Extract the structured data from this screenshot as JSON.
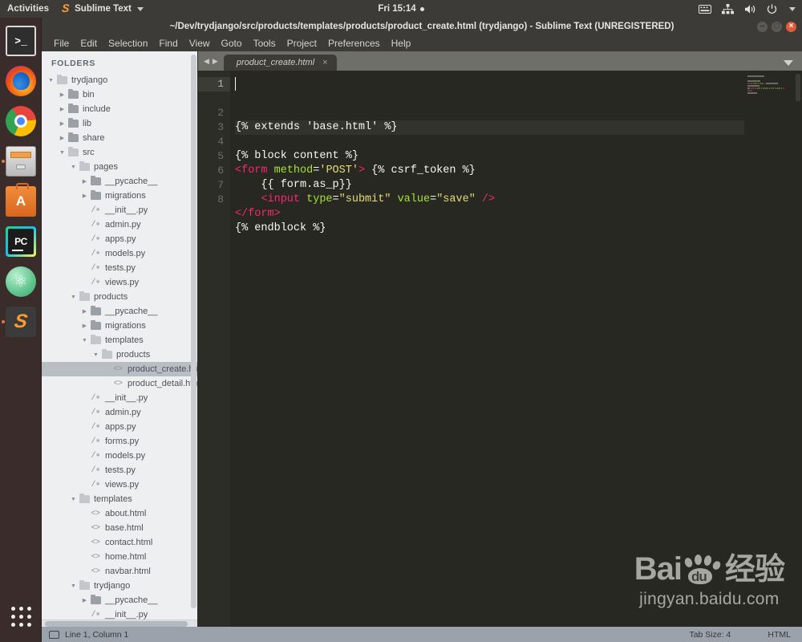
{
  "topbar": {
    "activities": "Activities",
    "app_name": "Sublime Text",
    "app_icon": "sublime-icon",
    "clock": "Fri 15:14",
    "tray_icons": [
      "keyboard-icon",
      "network-icon",
      "volume-icon",
      "power-icon"
    ]
  },
  "dock": {
    "items": [
      {
        "name": "terminal",
        "label": ">_",
        "running": false
      },
      {
        "name": "firefox",
        "label": "",
        "running": false
      },
      {
        "name": "chrome",
        "label": "",
        "running": false
      },
      {
        "name": "files",
        "label": "",
        "running": true
      },
      {
        "name": "ubuntu-software",
        "label": "A",
        "running": false
      },
      {
        "name": "pycharm",
        "label": "PC",
        "running": false
      },
      {
        "name": "atom",
        "label": "⚛",
        "running": false
      },
      {
        "name": "sublime-text",
        "label": "S",
        "running": true
      }
    ],
    "app_grid": "show-applications"
  },
  "window": {
    "title": "~/Dev/trydjango/src/products/templates/products/product_create.html (trydjango) - Sublime Text (UNREGISTERED)",
    "buttons": {
      "minimize": "–",
      "maximize": "□",
      "close": "×"
    }
  },
  "menubar": {
    "items": [
      "File",
      "Edit",
      "Selection",
      "Find",
      "View",
      "Goto",
      "Tools",
      "Project",
      "Preferences",
      "Help"
    ]
  },
  "sidebar": {
    "title": "FOLDERS",
    "scroll_position": "top",
    "tree": [
      {
        "label": "trydjango",
        "indent": 0,
        "type": "folder",
        "state": "open"
      },
      {
        "label": "bin",
        "indent": 1,
        "type": "folder",
        "state": "closed"
      },
      {
        "label": "include",
        "indent": 1,
        "type": "folder",
        "state": "closed"
      },
      {
        "label": "lib",
        "indent": 1,
        "type": "folder",
        "state": "closed"
      },
      {
        "label": "share",
        "indent": 1,
        "type": "folder",
        "state": "closed"
      },
      {
        "label": "src",
        "indent": 1,
        "type": "folder",
        "state": "open"
      },
      {
        "label": "pages",
        "indent": 2,
        "type": "folder",
        "state": "open"
      },
      {
        "label": "__pycache__",
        "indent": 3,
        "type": "folder",
        "state": "closed"
      },
      {
        "label": "migrations",
        "indent": 3,
        "type": "folder",
        "state": "closed"
      },
      {
        "label": "__init__.py",
        "indent": 3,
        "type": "py"
      },
      {
        "label": "admin.py",
        "indent": 3,
        "type": "py"
      },
      {
        "label": "apps.py",
        "indent": 3,
        "type": "py"
      },
      {
        "label": "models.py",
        "indent": 3,
        "type": "py"
      },
      {
        "label": "tests.py",
        "indent": 3,
        "type": "py"
      },
      {
        "label": "views.py",
        "indent": 3,
        "type": "py"
      },
      {
        "label": "products",
        "indent": 2,
        "type": "folder",
        "state": "open"
      },
      {
        "label": "__pycache__",
        "indent": 3,
        "type": "folder",
        "state": "closed"
      },
      {
        "label": "migrations",
        "indent": 3,
        "type": "folder",
        "state": "closed"
      },
      {
        "label": "templates",
        "indent": 3,
        "type": "folder",
        "state": "open"
      },
      {
        "label": "products",
        "indent": 4,
        "type": "folder",
        "state": "open"
      },
      {
        "label": "product_create.html",
        "indent": 5,
        "type": "html",
        "selected": true
      },
      {
        "label": "product_detail.html",
        "indent": 5,
        "type": "html"
      },
      {
        "label": "__init__.py",
        "indent": 3,
        "type": "py"
      },
      {
        "label": "admin.py",
        "indent": 3,
        "type": "py"
      },
      {
        "label": "apps.py",
        "indent": 3,
        "type": "py"
      },
      {
        "label": "forms.py",
        "indent": 3,
        "type": "py"
      },
      {
        "label": "models.py",
        "indent": 3,
        "type": "py"
      },
      {
        "label": "tests.py",
        "indent": 3,
        "type": "py"
      },
      {
        "label": "views.py",
        "indent": 3,
        "type": "py"
      },
      {
        "label": "templates",
        "indent": 2,
        "type": "folder",
        "state": "open"
      },
      {
        "label": "about.html",
        "indent": 3,
        "type": "html"
      },
      {
        "label": "base.html",
        "indent": 3,
        "type": "html"
      },
      {
        "label": "contact.html",
        "indent": 3,
        "type": "html"
      },
      {
        "label": "home.html",
        "indent": 3,
        "type": "html"
      },
      {
        "label": "navbar.html",
        "indent": 3,
        "type": "html"
      },
      {
        "label": "trydjango",
        "indent": 2,
        "type": "folder",
        "state": "open"
      },
      {
        "label": "__pycache__",
        "indent": 3,
        "type": "folder",
        "state": "closed"
      },
      {
        "label": "__init__.py",
        "indent": 3,
        "type": "py"
      }
    ]
  },
  "editor": {
    "tab": {
      "label": "product_create.html",
      "close": "×",
      "modified": false
    },
    "tab_nav_prev": "◀",
    "tab_nav_next": "▶",
    "tab_menu": "chevron-down-icon",
    "cursor_line": 1,
    "lines": [
      {
        "n": 1,
        "tokens": [
          {
            "t": "{% extends 'base.html' %}",
            "c": "plain"
          }
        ]
      },
      {
        "n": 2,
        "tokens": []
      },
      {
        "n": 3,
        "tokens": [
          {
            "t": "{% block content %}",
            "c": "plain"
          }
        ]
      },
      {
        "n": 4,
        "tokens": [
          {
            "t": "<form",
            "c": "tag"
          },
          {
            "t": " ",
            "c": "plain"
          },
          {
            "t": "method",
            "c": "attr"
          },
          {
            "t": "=",
            "c": "plain"
          },
          {
            "t": "'POST'",
            "c": "str"
          },
          {
            "t": ">",
            "c": "tag"
          },
          {
            "t": " {% csrf_token %}",
            "c": "plain"
          }
        ]
      },
      {
        "n": 5,
        "tokens": [
          {
            "t": "    {{ form.as_p}}",
            "c": "plain"
          }
        ]
      },
      {
        "n": 6,
        "tokens": [
          {
            "t": "    ",
            "c": "plain"
          },
          {
            "t": "<input",
            "c": "tag"
          },
          {
            "t": " ",
            "c": "plain"
          },
          {
            "t": "type",
            "c": "attr"
          },
          {
            "t": "=",
            "c": "plain"
          },
          {
            "t": "\"submit\"",
            "c": "str"
          },
          {
            "t": " ",
            "c": "plain"
          },
          {
            "t": "value",
            "c": "attr"
          },
          {
            "t": "=",
            "c": "plain"
          },
          {
            "t": "\"save\"",
            "c": "str"
          },
          {
            "t": " ",
            "c": "plain"
          },
          {
            "t": "/>",
            "c": "tag"
          }
        ]
      },
      {
        "n": 7,
        "tokens": [
          {
            "t": "</form>",
            "c": "tag"
          }
        ]
      },
      {
        "n": 8,
        "tokens": [
          {
            "t": "{% endblock %}",
            "c": "plain"
          }
        ]
      }
    ]
  },
  "watermark": {
    "brand": "Bai",
    "paw_text": "du",
    "cn": "经验",
    "url": "jingyan.baidu.com"
  },
  "statusbar": {
    "cursor": "Line 1, Column 1",
    "tab_size": "Tab Size: 4",
    "syntax": "HTML"
  },
  "colors": {
    "editor_bg": "#272822",
    "gutter_bg": "#2c2d26",
    "tag": "#f92672",
    "attr": "#a6e22e",
    "string": "#e6db74",
    "plain": "#f8f8f2",
    "sidebar_bg": "#edeff1",
    "chrome_bg": "#3c3b37",
    "status_bg": "#9ba2ab",
    "accent": "#ff9b33"
  }
}
